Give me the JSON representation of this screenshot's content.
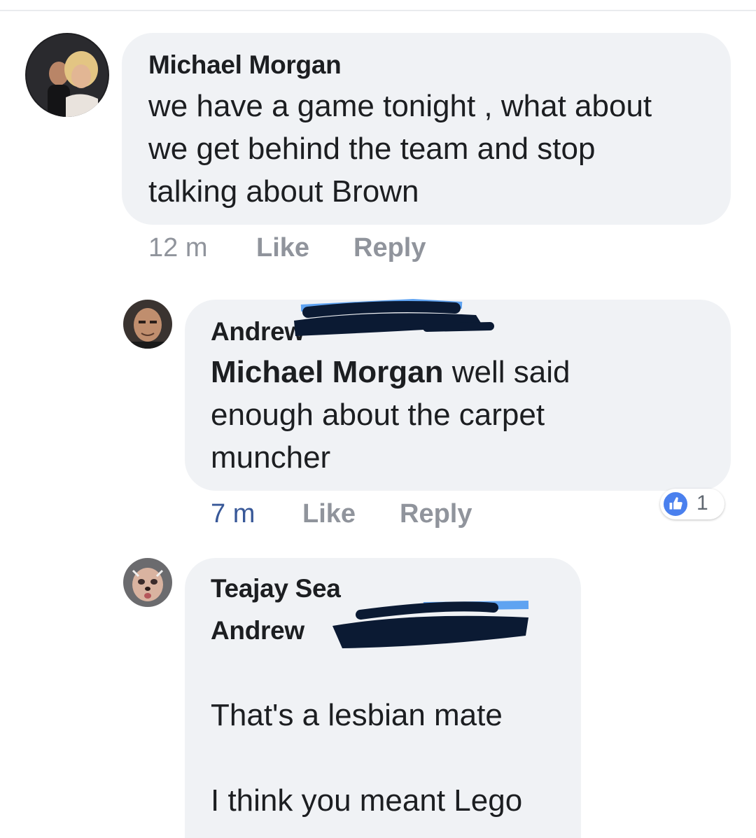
{
  "colors": {
    "bubble": "#f0f2f5",
    "text": "#1c1e21",
    "meta_gray": "#90949c",
    "time_blue": "#385898",
    "like_blue": "#4a80ee",
    "redaction": "#0b1a33"
  },
  "comments": [
    {
      "author": "Michael Morgan",
      "lines": [
        "we have a game tonight , what about",
        "we get behind the team and stop",
        "talking about Brown"
      ],
      "time": "12 m",
      "like_label": "Like",
      "reply_label": "Reply"
    },
    {
      "author": "Andrew",
      "author_redacted": true,
      "mention": "Michael Morgan",
      "lines": [
        " well said",
        "enough about the carpet",
        "muncher"
      ],
      "time": "7 m",
      "like_label": "Like",
      "reply_label": "Reply",
      "reaction_icon": "thumbs-up-icon",
      "reaction_count": "1"
    },
    {
      "author": "Teajay Sea",
      "mention": "Andrew",
      "mention_redacted": true,
      "lines": [
        "That's a lesbian mate",
        "I think you meant Lego"
      ]
    }
  ]
}
